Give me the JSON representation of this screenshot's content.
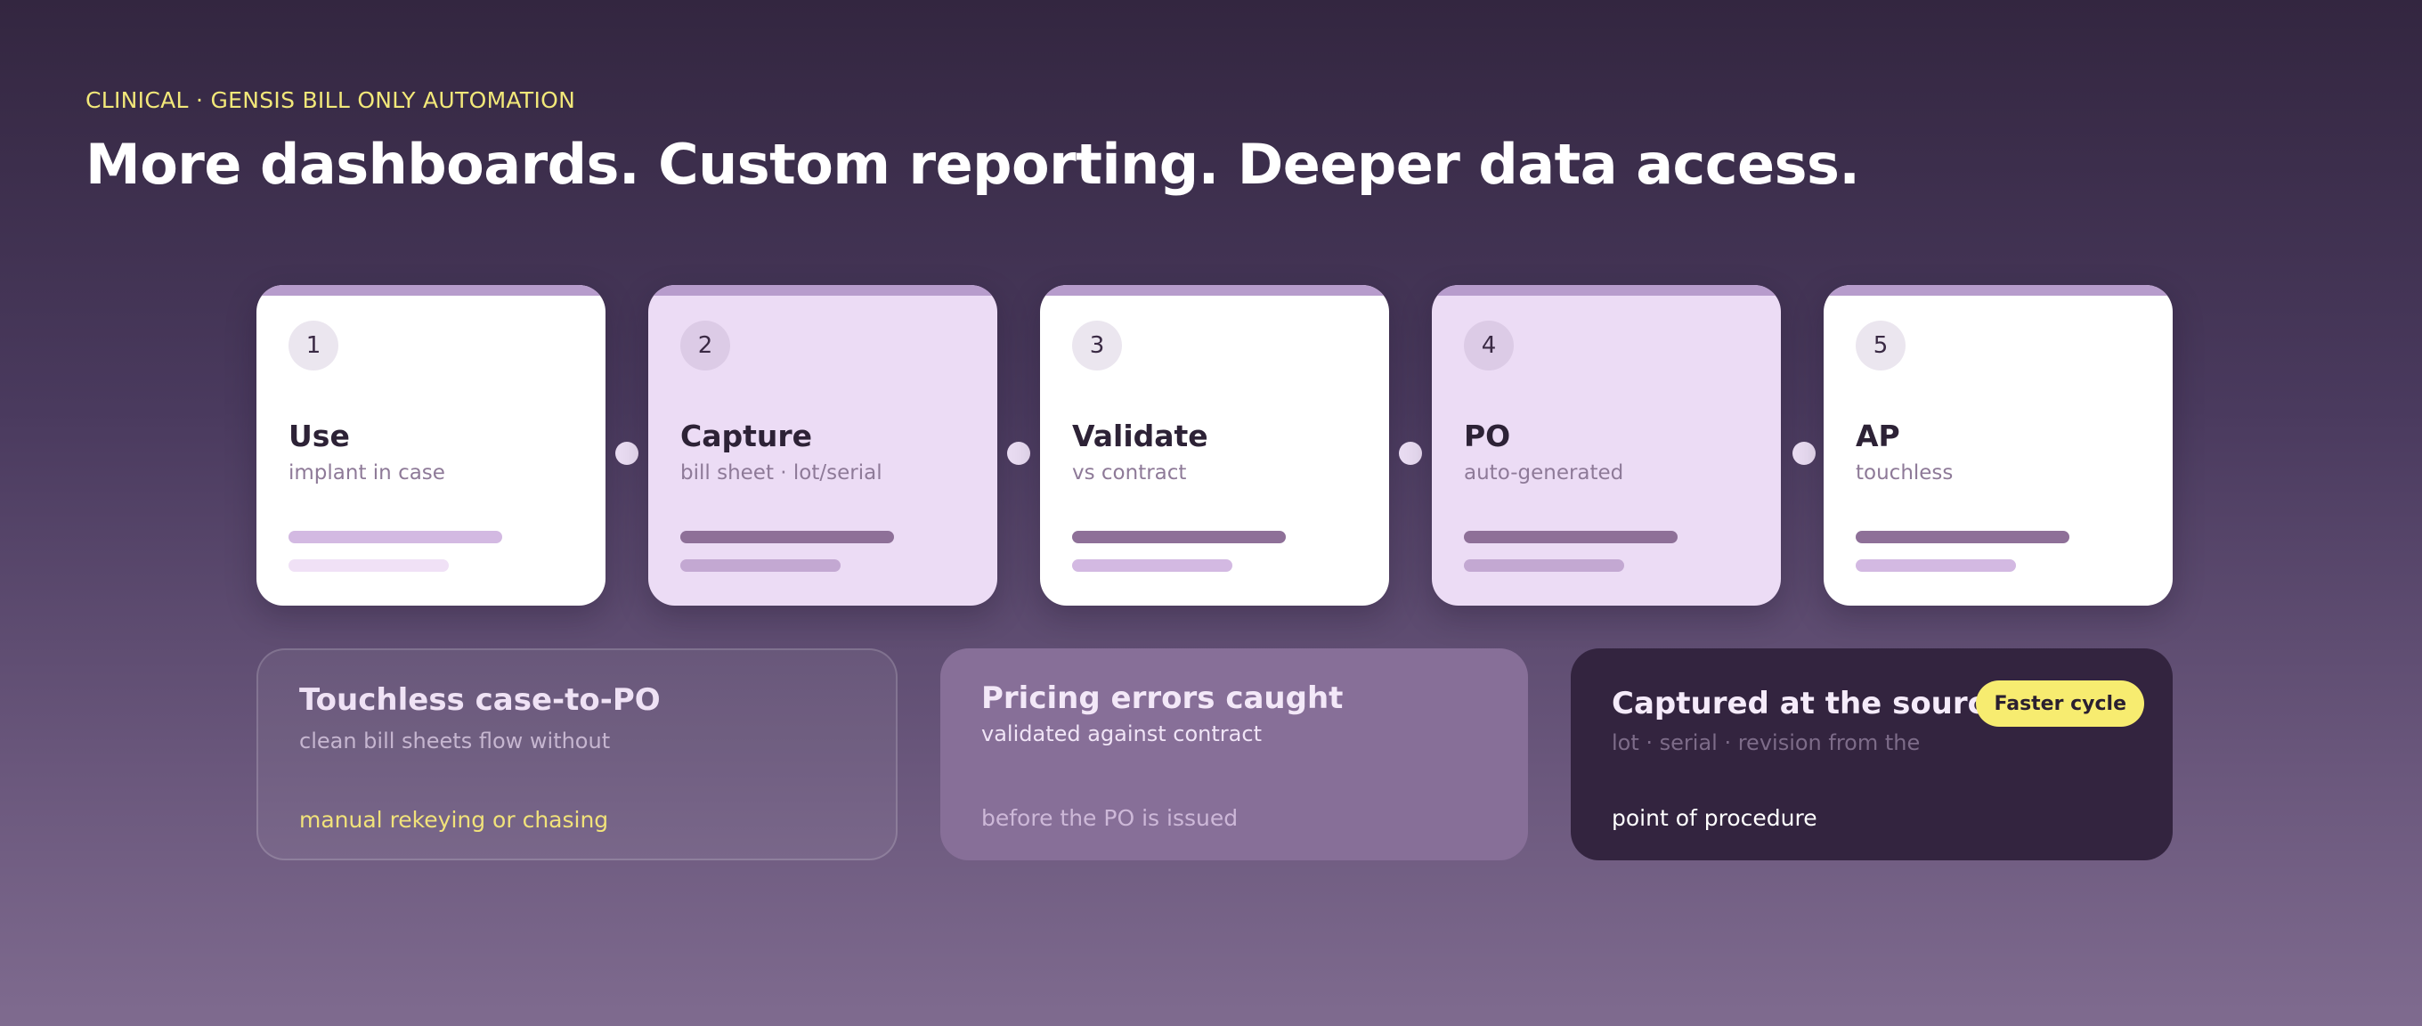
{
  "header": {
    "eyebrow": "CLINICAL · GENSIS BILL ONLY AUTOMATION",
    "title": "More dashboards. Custom reporting. Deeper data access."
  },
  "steps": [
    {
      "number": "1",
      "title": "Use",
      "subtitle": "implant in case"
    },
    {
      "number": "2",
      "title": "Capture",
      "subtitle": "bill sheet · lot/serial"
    },
    {
      "number": "3",
      "title": "Validate",
      "subtitle": "vs contract"
    },
    {
      "number": "4",
      "title": "PO",
      "subtitle": "auto-generated"
    },
    {
      "number": "5",
      "title": "AP",
      "subtitle": "touchless"
    }
  ],
  "outcomes": [
    {
      "title": "Touchless case-to-PO",
      "subtitle": "clean bill sheets flow without",
      "footer": "manual rekeying or chasing"
    },
    {
      "title": "Pricing errors caught",
      "subtitle": "validated against contract",
      "footer": "before the PO is issued"
    },
    {
      "title": "Captured at the source",
      "subtitle": "lot · serial · revision from the",
      "footer": "point of procedure",
      "badge": "Faster cycle"
    }
  ],
  "colors": {
    "accent_yellow": "#f2e879",
    "card_lavender": "#ecdcf5",
    "card_white": "#ffffff",
    "dark_card": "#33243f",
    "mid_card": "#876f98",
    "bar_light": "#d3b9e2",
    "bar_dark": "#8e7098"
  }
}
